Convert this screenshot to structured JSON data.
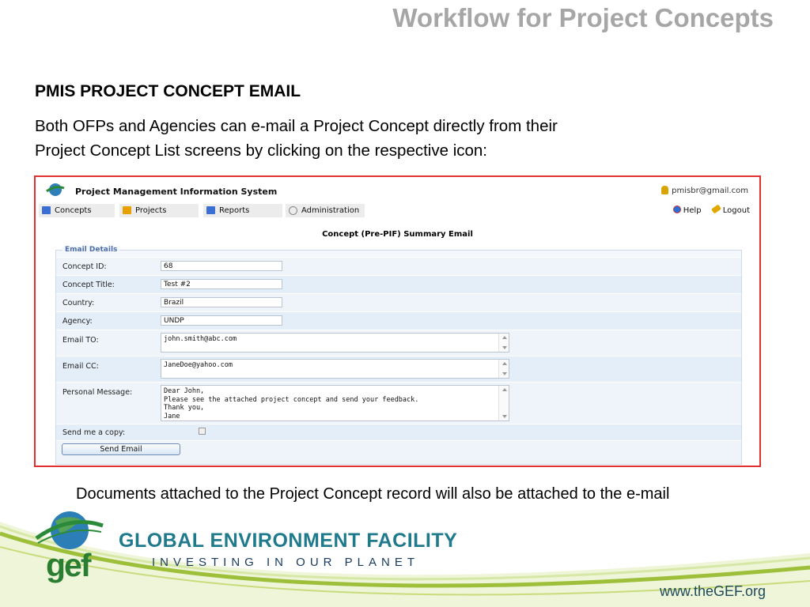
{
  "slide": {
    "title": "Workflow for Project Concepts",
    "heading": "PMIS PROJECT CONCEPT EMAIL",
    "body_line1": "Both OFPs and Agencies can e-mail a Project Concept directly from their",
    "body_line2": "Project Concept List screens by clicking on the respective icon:",
    "footnote": "Documents attached to the Project Concept record will also be attached to the e-mail"
  },
  "app": {
    "title": "Project Management Information System",
    "user_email": "pmisbr@gmail.com",
    "tabs": [
      {
        "label": "Concepts",
        "icon": "concepts-icon",
        "color": "#3b6fd4"
      },
      {
        "label": "Projects",
        "icon": "projects-icon",
        "color": "#e8a000"
      },
      {
        "label": "Reports",
        "icon": "reports-icon",
        "color": "#3b6fd4"
      },
      {
        "label": "Administration",
        "icon": "gear-icon",
        "color": "#888888"
      }
    ],
    "help_label": "Help",
    "logout_label": "Logout",
    "page_heading": "Concept (Pre-PIF) Summary Email",
    "legend": "Email Details",
    "fields": {
      "concept_id": {
        "label": "Concept ID:",
        "value": "68"
      },
      "concept_title": {
        "label": "Concept Title:",
        "value": "Test #2"
      },
      "country": {
        "label": "Country:",
        "value": "Brazil"
      },
      "agency": {
        "label": "Agency:",
        "value": "UNDP"
      },
      "email_to": {
        "label": "Email TO:",
        "value": "john.smith@abc.com"
      },
      "email_cc": {
        "label": "Email CC:",
        "value": "JaneDoe@yahoo.com"
      },
      "personal_message": {
        "label": "Personal Message:",
        "value": "Dear John,\nPlease see the attached project concept and send your feedback.\nThank you,\nJane"
      },
      "send_copy": {
        "label": "Send me a copy:",
        "checked": false
      }
    },
    "send_button": "Send Email"
  },
  "footer": {
    "org_name": "GLOBAL ENVIRONMENT FACILITY",
    "tagline": "INVESTING IN OUR PLANET",
    "logo_text": "gef",
    "website": "www.theGEF.org"
  },
  "colors": {
    "frame_border": "#e03030",
    "slide_title": "#a6a6a6",
    "gef_green": "#2a7e31",
    "gef_teal": "#1f7a8c"
  }
}
